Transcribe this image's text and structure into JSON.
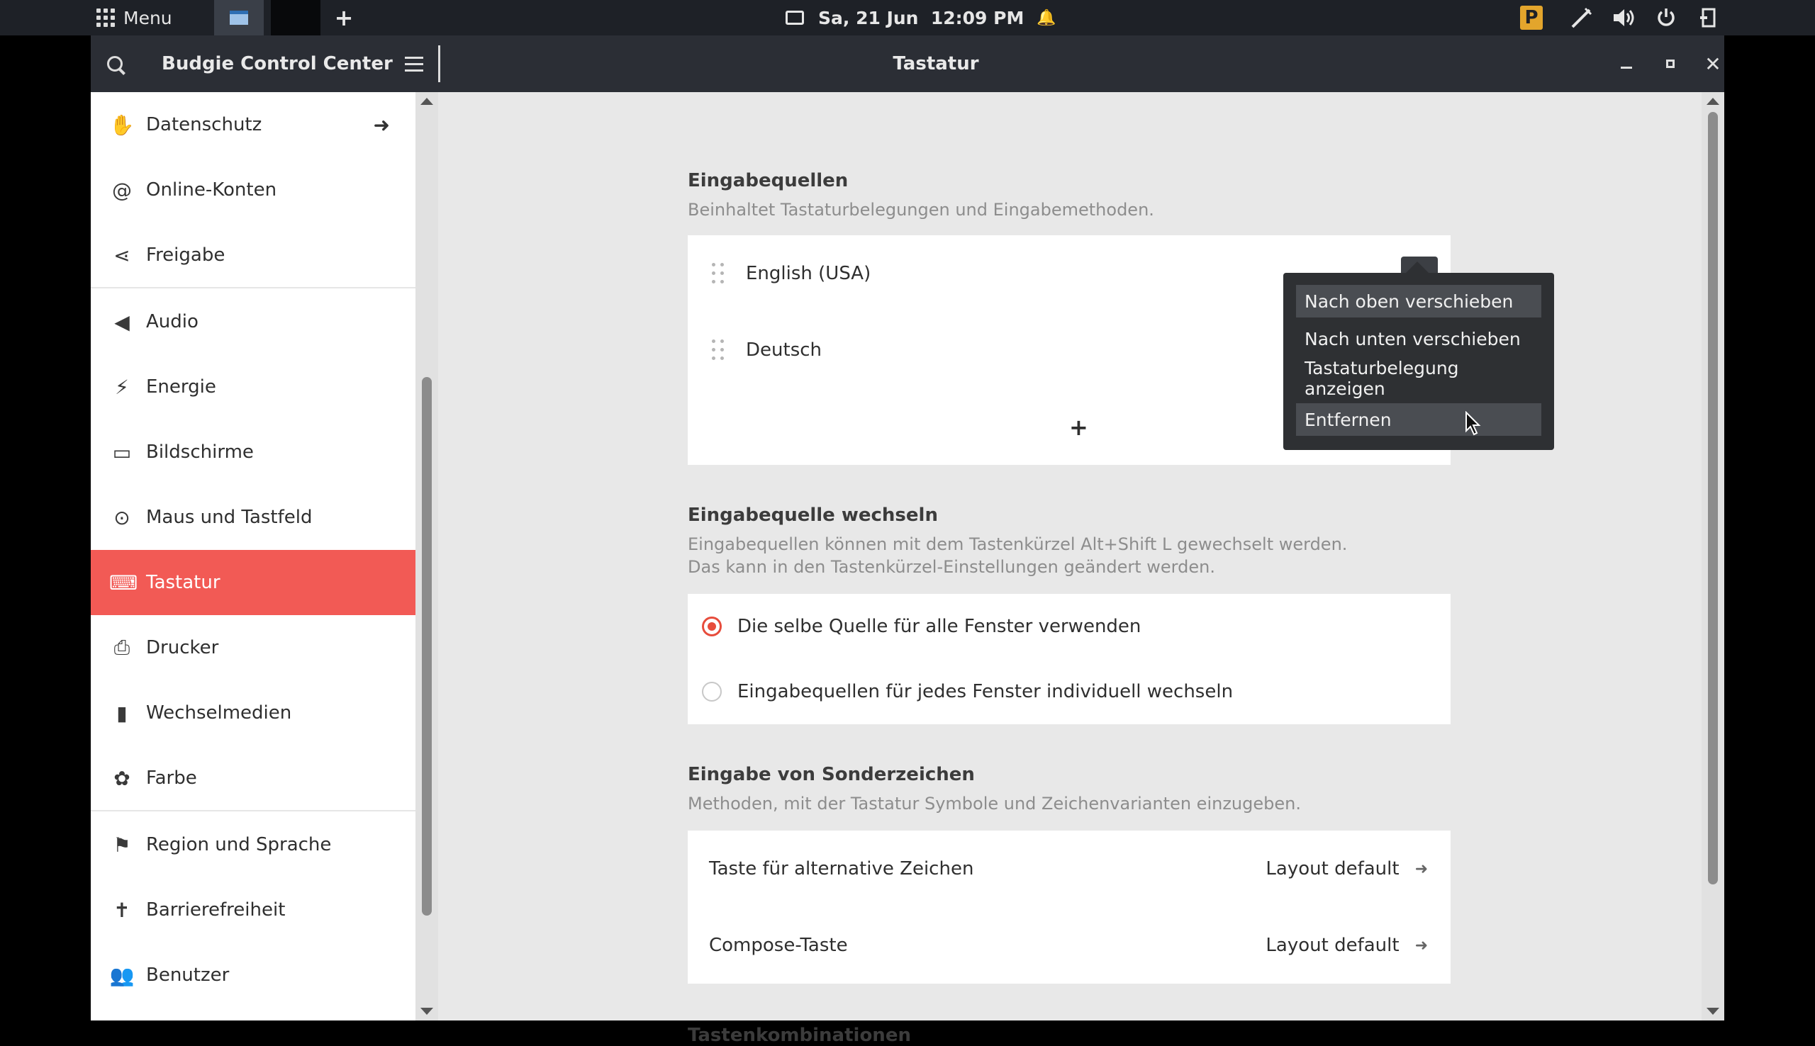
{
  "panel": {
    "menu_label": "Menu",
    "new_label": "+",
    "datetime": "Sa, 21 Jun  12:09 PM",
    "bell": "🔔",
    "tray_p": "P"
  },
  "window": {
    "app_name": "Budgie Control Center",
    "title": "Tastatur",
    "close": "✕"
  },
  "sidebar": {
    "items": [
      {
        "label": "Datenschutz",
        "icon": "✋"
      },
      {
        "label": "Online-Konten",
        "icon": "@"
      },
      {
        "label": "Freigabe",
        "icon": "⋖"
      },
      {
        "label": "Audio",
        "icon": "◀"
      },
      {
        "label": "Energie",
        "icon": "⚡"
      },
      {
        "label": "Bildschirme",
        "icon": "▭"
      },
      {
        "label": "Maus und Tastfeld",
        "icon": "⊙"
      },
      {
        "label": "Tastatur",
        "icon": "⌨"
      },
      {
        "label": "Drucker",
        "icon": "⎙"
      },
      {
        "label": "Wechselmedien",
        "icon": "▮"
      },
      {
        "label": "Farbe",
        "icon": "✿"
      },
      {
        "label": "Region und Sprache",
        "icon": "⚑"
      },
      {
        "label": "Barrierefreiheit",
        "icon": "✝"
      },
      {
        "label": "Benutzer",
        "icon": "👥"
      }
    ],
    "arrow": "➜"
  },
  "content": {
    "input_sources": {
      "title": "Eingabequellen",
      "subtitle": "Beinhaltet Tastaturbelegungen und Eingabemethoden.",
      "sources": [
        "English (USA)",
        "Deutsch"
      ],
      "add": "+"
    },
    "switch": {
      "title": "Eingabequelle wechseln",
      "subtitle_1": "Eingabequellen können mit dem Tastenkürzel Alt+Shift L gewechselt werden.",
      "subtitle_2": "Das kann in den Tastenkürzel-Einstellungen geändert werden.",
      "options": [
        "Die selbe Quelle für alle Fenster verwenden",
        "Eingabequellen für jedes Fenster individuell wechseln"
      ],
      "selected": 0
    },
    "special": {
      "title": "Eingabe von Sonderzeichen",
      "subtitle": "Methoden, mit der Tastatur Symbole und Zeichenvarianten einzugeben.",
      "rows": [
        {
          "label": "Taste für alternative Zeichen",
          "value": "Layout default"
        },
        {
          "label": "Compose-Taste",
          "value": "Layout default"
        }
      ],
      "arrow": "➜"
    },
    "shortcuts": {
      "title": "Tastenkombinationen"
    }
  },
  "popover": {
    "items": [
      "Nach oben verschieben",
      "Nach unten verschieben",
      "Tastaturbelegung anzeigen",
      "Entfernen"
    ]
  },
  "colors": {
    "accent": "#f25a55",
    "radio": "#e74c3c",
    "headerbar": "#2b2e35"
  }
}
